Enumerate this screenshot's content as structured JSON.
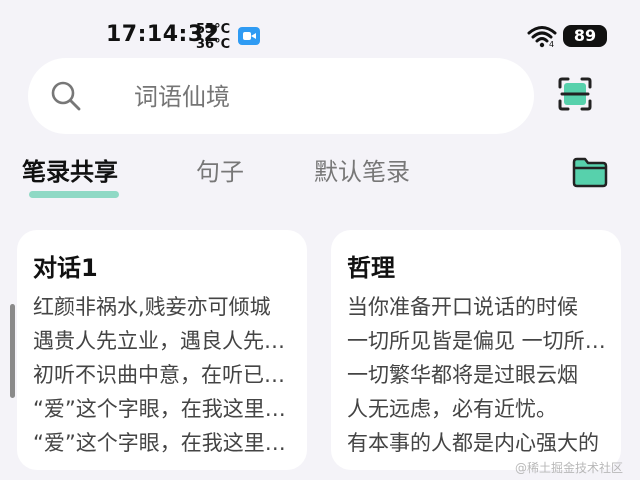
{
  "status_bar": {
    "time": "17:14:32",
    "temp_top": "55°C",
    "temp_bottom": "36°C",
    "battery": "89",
    "accent_color": "#2f9bf3"
  },
  "search": {
    "placeholder": "词语仙境"
  },
  "tabs": [
    {
      "label": "笔录共享",
      "active": true
    },
    {
      "label": "句子",
      "active": false
    },
    {
      "label": "默认笔录",
      "active": false
    }
  ],
  "indicator_color": "#8fd9c5",
  "icon_accent": "#57d1ac",
  "cards": [
    {
      "title": "对话1",
      "lines": [
        "红颜非祸水,贱妾亦可倾城",
        "遇贵人先立业，遇良人先成家",
        "初听不识曲中意，在听已是曲中人",
        "“爱”这个字眼，在我这里是永恒",
        "“爱”这个字眼，在我这里是永恒"
      ]
    },
    {
      "title": "哲理",
      "lines": [
        "当你准备开口说话的时候",
        "一切所见皆是偏见 一切所闻皆是观点",
        "一切繁华都将是过眼云烟",
        "人无远虑，必有近忧。",
        "有本事的人都是内心强大的"
      ]
    }
  ],
  "watermark": "@稀土掘金技术社区"
}
